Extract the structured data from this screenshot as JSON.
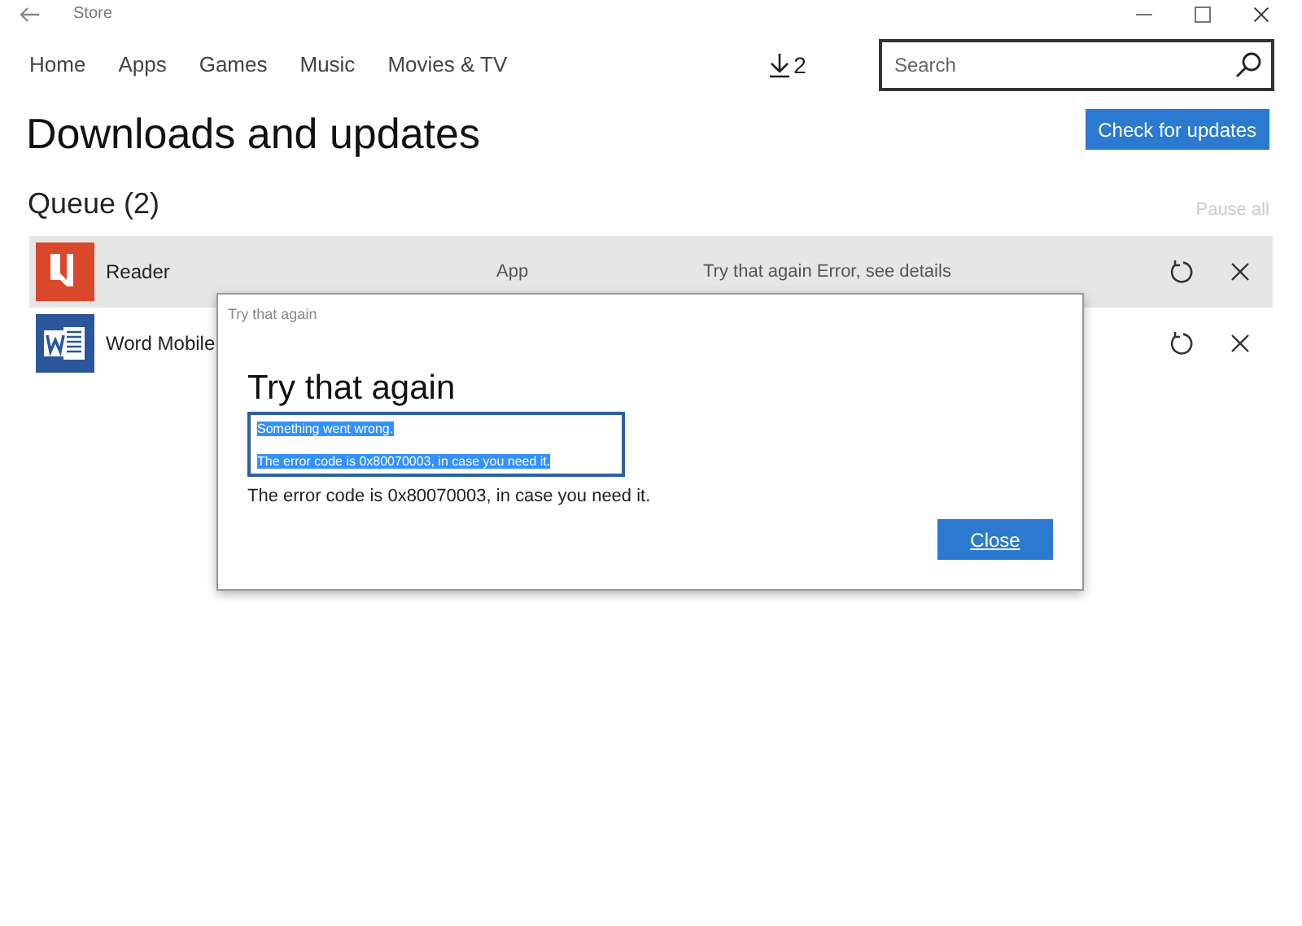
{
  "window": {
    "title": "Store"
  },
  "nav": [
    {
      "label": "Home"
    },
    {
      "label": "Apps"
    },
    {
      "label": "Games"
    },
    {
      "label": "Music"
    },
    {
      "label": "Movies & TV"
    }
  ],
  "downloads_count": "2",
  "search": {
    "placeholder": "Search"
  },
  "page_title": "Downloads and updates",
  "check_button": "Check for updates",
  "queue_title": "Queue (2)",
  "pause_all": {
    "label": "Pause all",
    "disabled": true
  },
  "queue": [
    {
      "name": "Reader",
      "kind": "reader",
      "type": "App",
      "status": "Try that again Error, see details",
      "selected": true
    },
    {
      "name": "Word Mobile",
      "kind": "word",
      "selected": false
    }
  ],
  "dialog": {
    "caption": "Try that again",
    "title": "Try that again",
    "selected_text": [
      "Something went wrong.",
      "The error code is 0x80070003, in case you need it."
    ],
    "message": "The error code is 0x80070003, in case you need it.",
    "button": "Close"
  }
}
